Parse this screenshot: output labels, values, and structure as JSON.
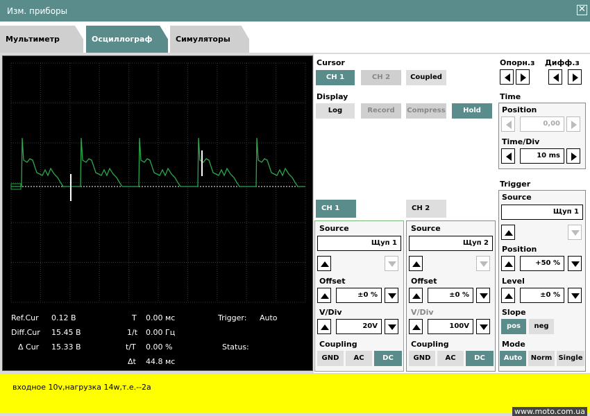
{
  "window": {
    "title": "Изм. приборы",
    "close": "✕"
  },
  "tabs": [
    {
      "label": "Мультиметр"
    },
    {
      "label": "Осциллограф"
    },
    {
      "label": "Симуляторы"
    }
  ],
  "readouts": {
    "ref_cur_label": "Ref.Cur",
    "ref_cur_value": "0.12 В",
    "diff_cur_label": "Diff.Cur",
    "diff_cur_value": "15.45 В",
    "delta_cur_label": "Δ Cur",
    "delta_cur_value": "15.33 В",
    "t_label": "T",
    "t_value": "0.00 мс",
    "inv_t_label": "1/t",
    "inv_t_value": "0.00 Гц",
    "t_ratio_label": "t/T",
    "t_ratio_value": "0.00 %",
    "dt_label": "Δt",
    "dt_value": "44.8 мс",
    "trigger_label": "Trigger:",
    "trigger_value": "Auto",
    "status_label": "Status:"
  },
  "cursor": {
    "title": "Cursor",
    "ch1": "CH 1",
    "ch2": "CH 2",
    "coupled": "Coupled"
  },
  "display": {
    "title": "Display",
    "log": "Log",
    "record": "Record",
    "compress": "Compress",
    "hold": "Hold"
  },
  "ref_diff": {
    "ref": "Опорн.з",
    "diff": "Дифф.з"
  },
  "time": {
    "title": "Time",
    "position_label": "Position",
    "position_value": "0,00",
    "timediv_label": "Time/Div",
    "timediv_value": "10 ms"
  },
  "channels": [
    {
      "tab": "CH 1",
      "source_label": "Source",
      "source_value": "Щуп 1",
      "offset_label": "Offset",
      "offset_value": "±0 %",
      "vdiv_label": "V/Div",
      "vdiv_value": "20V",
      "coupling_label": "Coupling",
      "gnd": "GND",
      "ac": "AC",
      "dc": "DC"
    },
    {
      "tab": "CH 2",
      "source_label": "Source",
      "source_value": "Щуп 2",
      "offset_label": "Offset",
      "offset_value": "±0 %",
      "vdiv_label": "V/Div",
      "vdiv_value": "100V",
      "coupling_label": "Coupling",
      "gnd": "GND",
      "ac": "AC",
      "dc": "DC"
    }
  ],
  "trigger": {
    "title": "Trigger",
    "source_label": "Source",
    "source_value": "Щуп 1",
    "position_label": "Position",
    "position_value": "+50 %",
    "level_label": "Level",
    "level_value": "±0 %",
    "slope_label": "Slope",
    "pos": "pos",
    "neg": "neg",
    "mode_label": "Mode",
    "auto": "Auto",
    "norm": "Norm",
    "single": "Single"
  },
  "note": "входное 10v,нагрузка 14w,т.е.--2a",
  "watermark": "www.moto.com.ua",
  "colors": {
    "accent": "#5a8c8c",
    "trace": "#2aa84a",
    "note_bg": "#ffff00"
  }
}
